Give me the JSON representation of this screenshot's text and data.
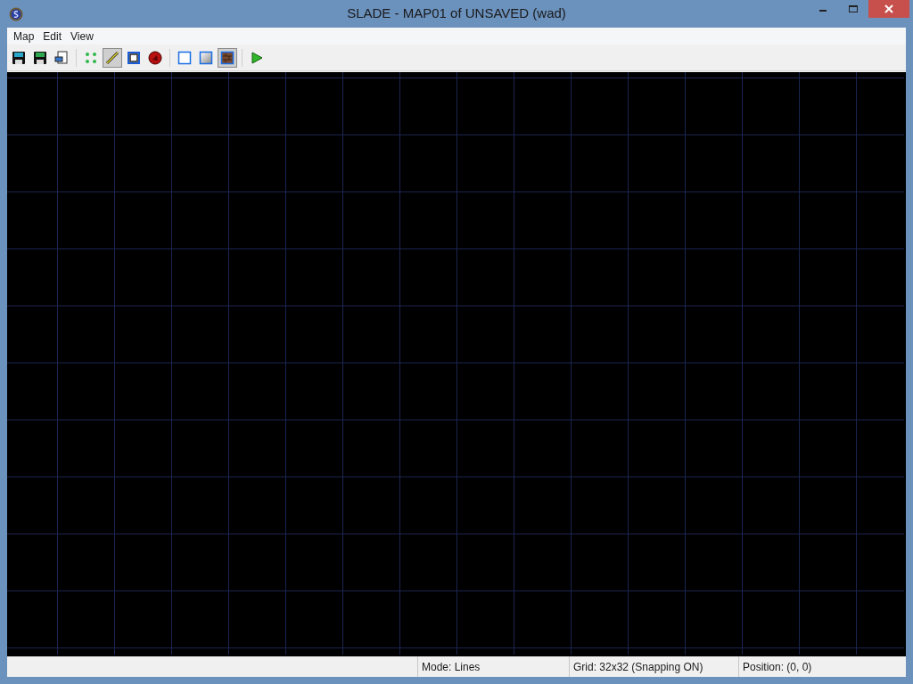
{
  "window": {
    "title": "SLADE - MAP01 of UNSAVED (wad)"
  },
  "menu": [
    "Map",
    "Edit",
    "View"
  ],
  "toolbar": [
    {
      "kind": "save",
      "selected": false
    },
    {
      "kind": "saveall",
      "selected": false
    },
    {
      "kind": "print",
      "selected": false
    },
    {
      "kind": "sep"
    },
    {
      "kind": "vertices",
      "selected": false
    },
    {
      "kind": "lines",
      "selected": true
    },
    {
      "kind": "sectors",
      "selected": false
    },
    {
      "kind": "things",
      "selected": false
    },
    {
      "kind": "sep"
    },
    {
      "kind": "flat",
      "selected": false
    },
    {
      "kind": "gradient",
      "selected": false
    },
    {
      "kind": "texture",
      "selected": true
    },
    {
      "kind": "sep"
    },
    {
      "kind": "play",
      "selected": false
    }
  ],
  "status_bar": [
    "Mode: Lines",
    "Grid: 32x32 (Snapping ON)",
    "Position: (0, 0)"
  ]
}
